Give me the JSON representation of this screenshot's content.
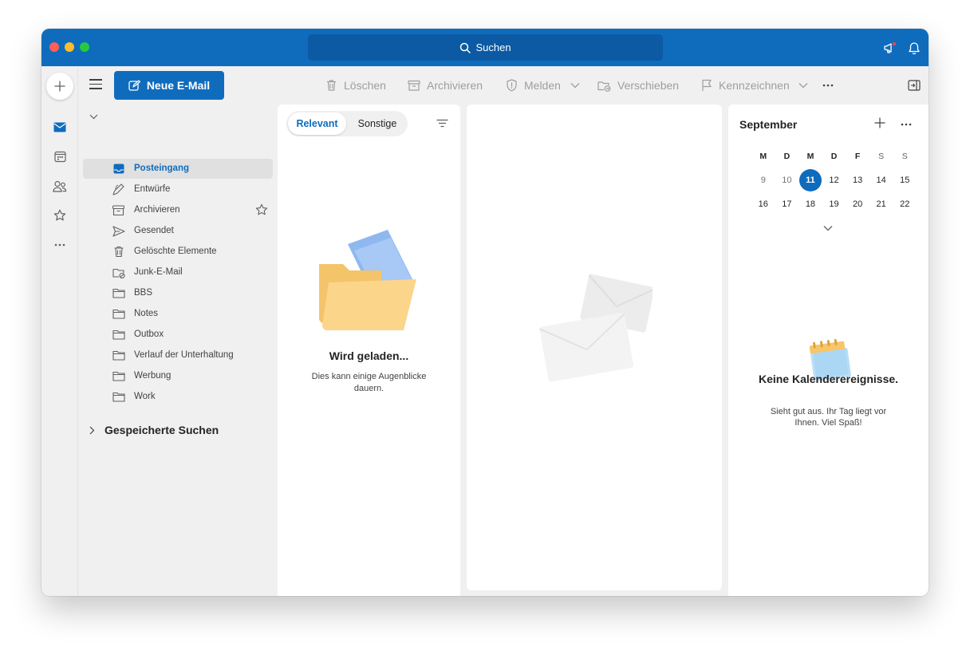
{
  "titlebar": {
    "search_label": "Suchen"
  },
  "toolbar": {
    "new_mail_label": "Neue E-Mail",
    "delete_label": "Löschen",
    "archive_label": "Archivieren",
    "report_label": "Melden",
    "move_label": "Verschieben",
    "flag_label": "Kennzeichnen"
  },
  "folders": {
    "account_label": "",
    "items": [
      {
        "label": "Posteingang",
        "icon": "inbox-icon",
        "selected": true
      },
      {
        "label": "Entwürfe",
        "icon": "drafts-icon"
      },
      {
        "label": "Archivieren",
        "icon": "archive-icon"
      },
      {
        "label": "Gesendet",
        "icon": "sent-icon"
      },
      {
        "label": "Gelöschte Elemente",
        "icon": "trash-icon"
      },
      {
        "label": "Junk-E-Mail",
        "icon": "junk-icon"
      },
      {
        "label": "BBS",
        "icon": "folder-icon"
      },
      {
        "label": "Notes",
        "icon": "folder-icon"
      },
      {
        "label": "Outbox",
        "icon": "folder-icon"
      },
      {
        "label": "Verlauf der Unterhaltung",
        "icon": "folder-icon"
      },
      {
        "label": "Werbung",
        "icon": "folder-icon"
      },
      {
        "label": "Work",
        "icon": "folder-icon"
      }
    ],
    "saved_searches_label": "Gespeicherte Suchen"
  },
  "message_list": {
    "tab_focused": "Relevant",
    "tab_other": "Sonstige",
    "loading_title": "Wird geladen...",
    "loading_subtitle": "Dies kann einige Augenblicke dauern."
  },
  "calendar": {
    "month": "September",
    "weekdays": [
      "M",
      "D",
      "M",
      "D",
      "F",
      "S",
      "S"
    ],
    "weeks": [
      [
        "9",
        "10",
        "11",
        "12",
        "13",
        "14",
        "15"
      ],
      [
        "16",
        "17",
        "18",
        "19",
        "20",
        "21",
        "22"
      ]
    ],
    "today": "11",
    "empty_title": "Keine Kalenderereignisse.",
    "empty_subtitle": "Sieht gut aus. Ihr Tag liegt vor Ihnen. Viel Spaß!"
  },
  "colors": {
    "brand": "#0f6cbd",
    "titlebar": "#0f6cbd",
    "search_bg": "#0b5aa3",
    "selected_folder_bg": "#e0e0e0"
  }
}
